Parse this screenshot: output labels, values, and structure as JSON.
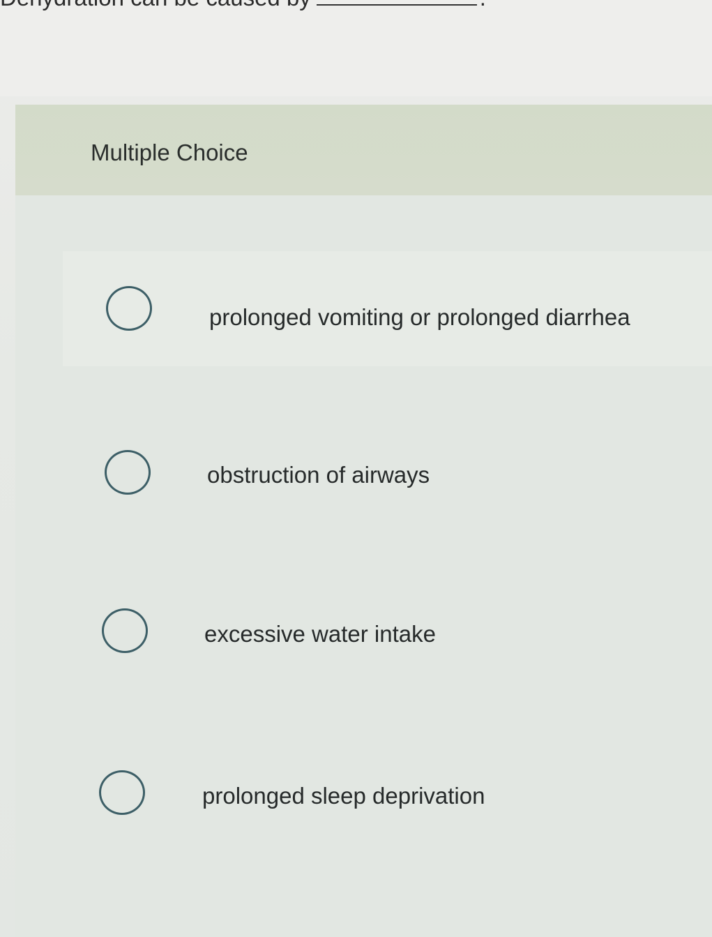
{
  "question": {
    "text": "Dehydration can be caused by",
    "period": "."
  },
  "header": {
    "title": "Multiple Choice"
  },
  "choices": [
    {
      "label": "prolonged vomiting or prolonged diarrhea"
    },
    {
      "label": "obstruction of airways"
    },
    {
      "label": "excessive water intake"
    },
    {
      "label": "prolonged sleep deprivation"
    }
  ],
  "colors": {
    "header_band": "#d3dbc9",
    "radio_border": "#3d5f67",
    "text": "#262a2a"
  }
}
